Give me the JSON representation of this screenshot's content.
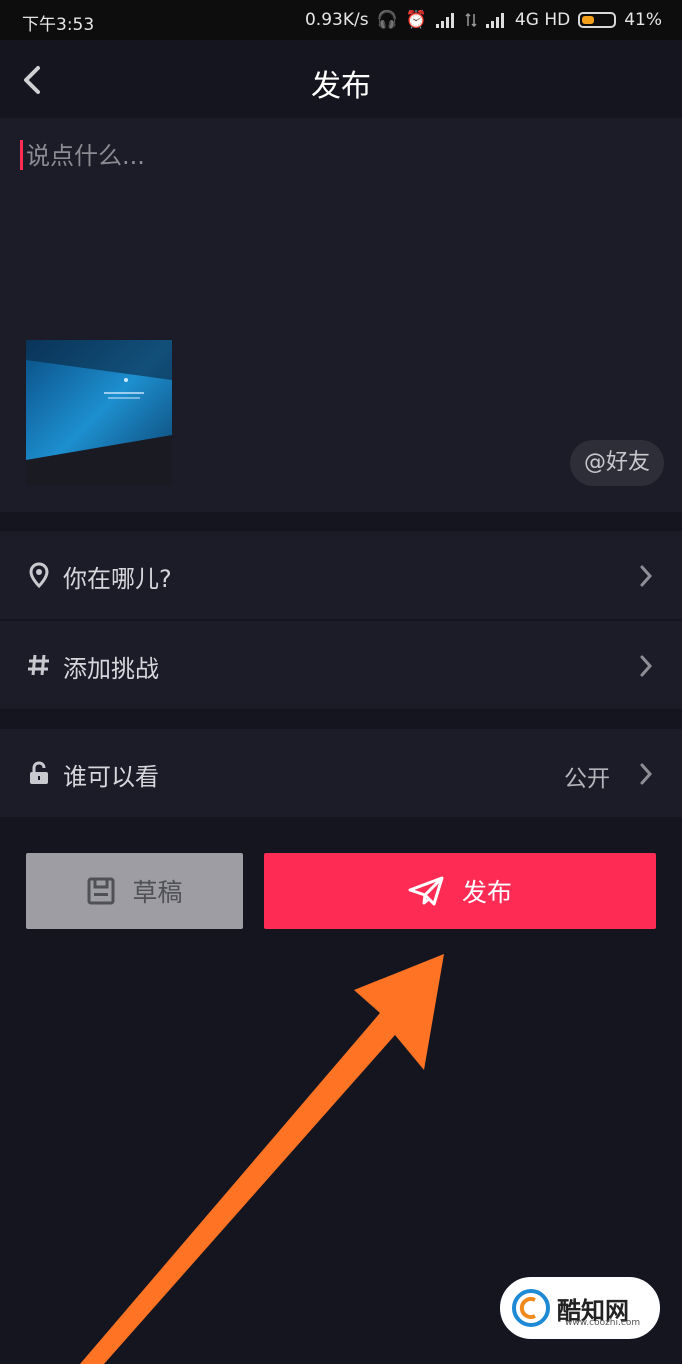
{
  "status_bar": {
    "time": "下午3:53",
    "speed": "0.93K/s",
    "network": "4G HD",
    "battery": "41%",
    "battery_level": 0.41,
    "battery_color": "#f2a01b"
  },
  "header": {
    "back_icon": "chevron-left-icon",
    "title": "发布"
  },
  "compose": {
    "placeholder": "说点什么...",
    "mention_label": "@好友"
  },
  "rows": {
    "location": {
      "icon": "location-pin-icon",
      "label": "你在哪儿?"
    },
    "challenge": {
      "icon": "hashtag-icon",
      "label": "添加挑战"
    },
    "privacy": {
      "icon": "lock-icon",
      "label": "谁可以看",
      "value": "公开"
    }
  },
  "actions": {
    "draft_label": "草稿",
    "publish_label": "发布",
    "accent": "#fe2c55"
  },
  "watermark": {
    "brand": "酷知网",
    "url": "www.coozhi.com"
  }
}
